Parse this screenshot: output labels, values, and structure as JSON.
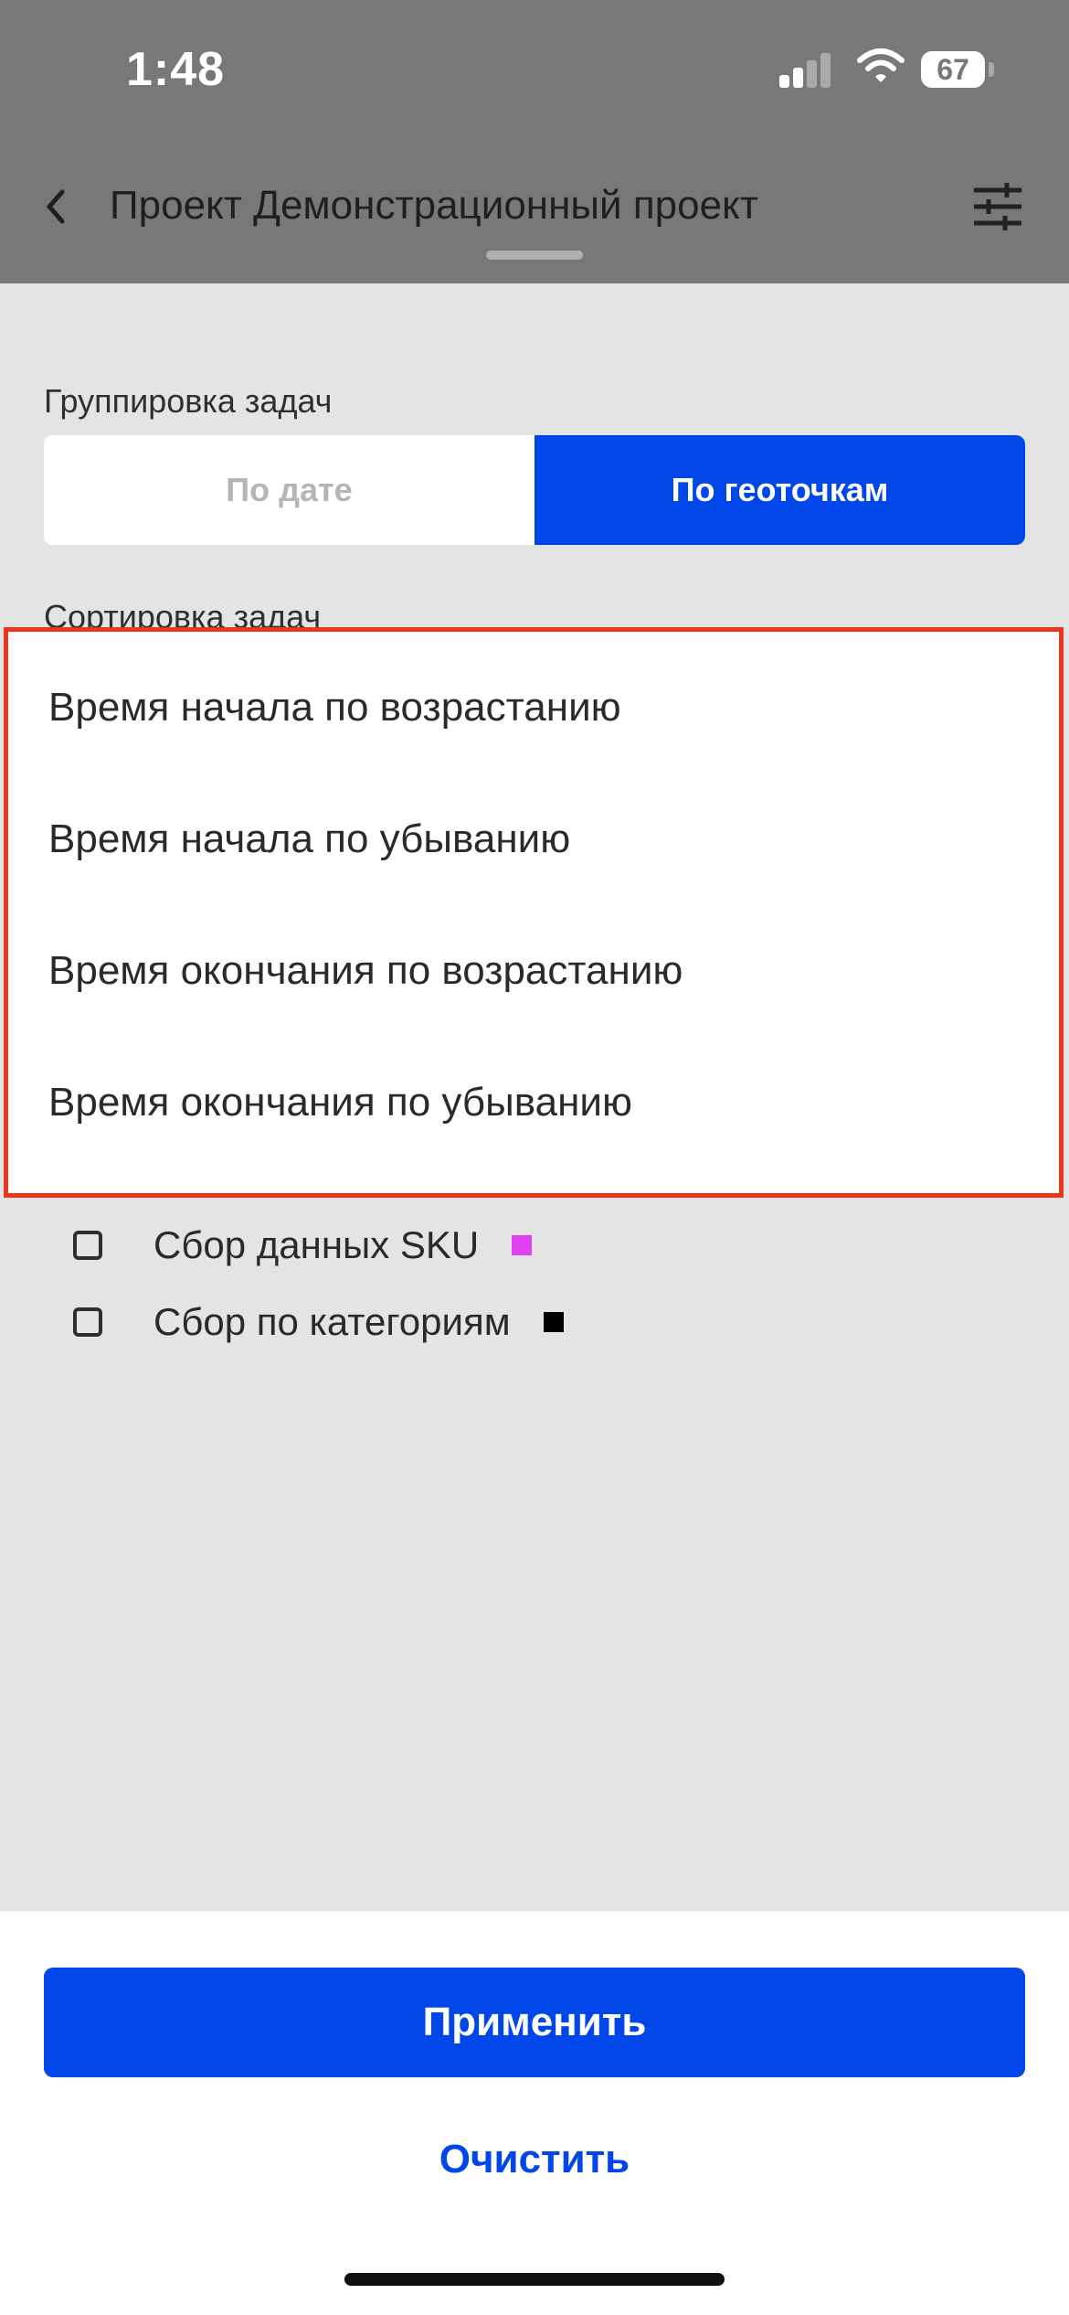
{
  "status_bar": {
    "time": "1:48",
    "battery": "67"
  },
  "nav": {
    "title": "Проект Демонстрационный проект"
  },
  "grouping": {
    "label": "Группировка задач",
    "options": [
      "По дате",
      "По геоточкам"
    ],
    "selected": "По геоточкам"
  },
  "sorting": {
    "label": "Сортировка задач",
    "options": [
      "Время начала по возрастанию",
      "Время начала по убыванию",
      "Время окончания по возрастанию",
      "Время окончания по убыванию"
    ]
  },
  "checklist": [
    {
      "label": "Сбор данных SKU",
      "color": "#e040f0",
      "checked": false
    },
    {
      "label": "Сбор по категориям",
      "color": "#000000",
      "checked": false
    }
  ],
  "actions": {
    "apply": "Применить",
    "clear": "Очистить"
  },
  "colors": {
    "accent": "#0046e8",
    "highlight_border": "#e9371e"
  },
  "icons": [
    "chevron-left-icon",
    "filter-sliders-icon",
    "signal-icon",
    "wifi-icon",
    "battery-icon"
  ]
}
